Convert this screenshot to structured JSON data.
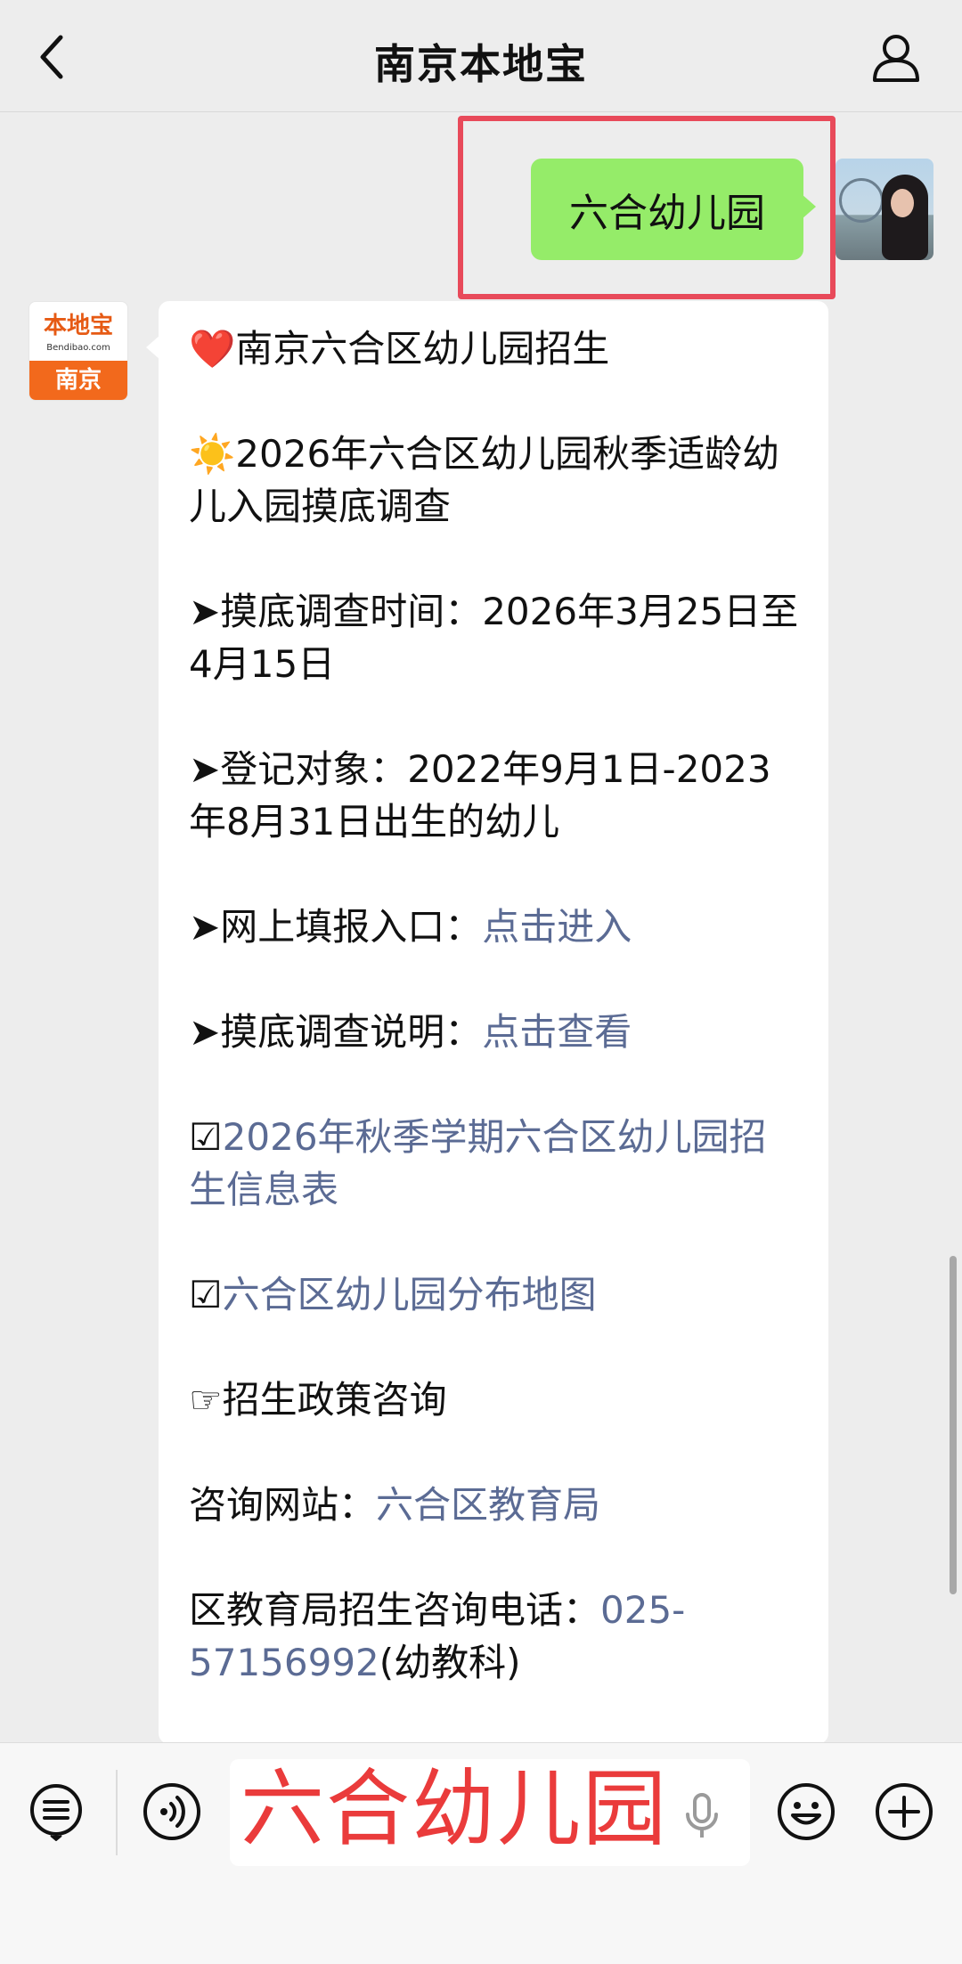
{
  "header": {
    "title": "南京本地宝",
    "back_icon": "chevron-left-icon",
    "profile_icon": "person-icon"
  },
  "outgoing": {
    "text": "六合幼儿园",
    "bubble_color": "#95ec69",
    "highlight_color": "#e84a5a"
  },
  "brand_avatar": {
    "top": "本地宝",
    "url": "Bendibao.com",
    "bottom": "南京"
  },
  "message": {
    "title": {
      "icon": "❤️",
      "text": "南京六合区幼儿园招生"
    },
    "survey": {
      "icon": "☀️",
      "text": "2026年六合区幼儿园秋季适龄幼儿入园摸底调查"
    },
    "time": {
      "prefix": "➤摸底调查时间：",
      "value": "2026年3月25日至4月15日"
    },
    "target": {
      "prefix": "➤登记对象：",
      "value": "2022年9月1日-2023年8月31日出生的幼儿"
    },
    "online": {
      "prefix": "➤网上填报入口：",
      "link": "点击进入"
    },
    "explain": {
      "prefix": "➤摸底调查说明：",
      "link": "点击查看"
    },
    "info_table": {
      "icon": "☑",
      "link": "2026年秋季学期六合区幼儿园招生信息表"
    },
    "map": {
      "icon": "☑",
      "link": "六合区幼儿园分布地图"
    },
    "policy": {
      "icon": "☞",
      "text": "招生政策咨询"
    },
    "website": {
      "prefix": "咨询网站：",
      "link": "六合区教育局"
    },
    "phone": {
      "prefix": "区教育局招生咨询电话：",
      "link": "025-57156992",
      "suffix": "(幼教科)"
    },
    "link_color": "#5b6b94"
  },
  "input_bar": {
    "value": "六合幼儿园",
    "icons": [
      "list-menu-icon",
      "voice-icon",
      "microphone-icon",
      "emoji-icon",
      "plus-icon"
    ]
  }
}
